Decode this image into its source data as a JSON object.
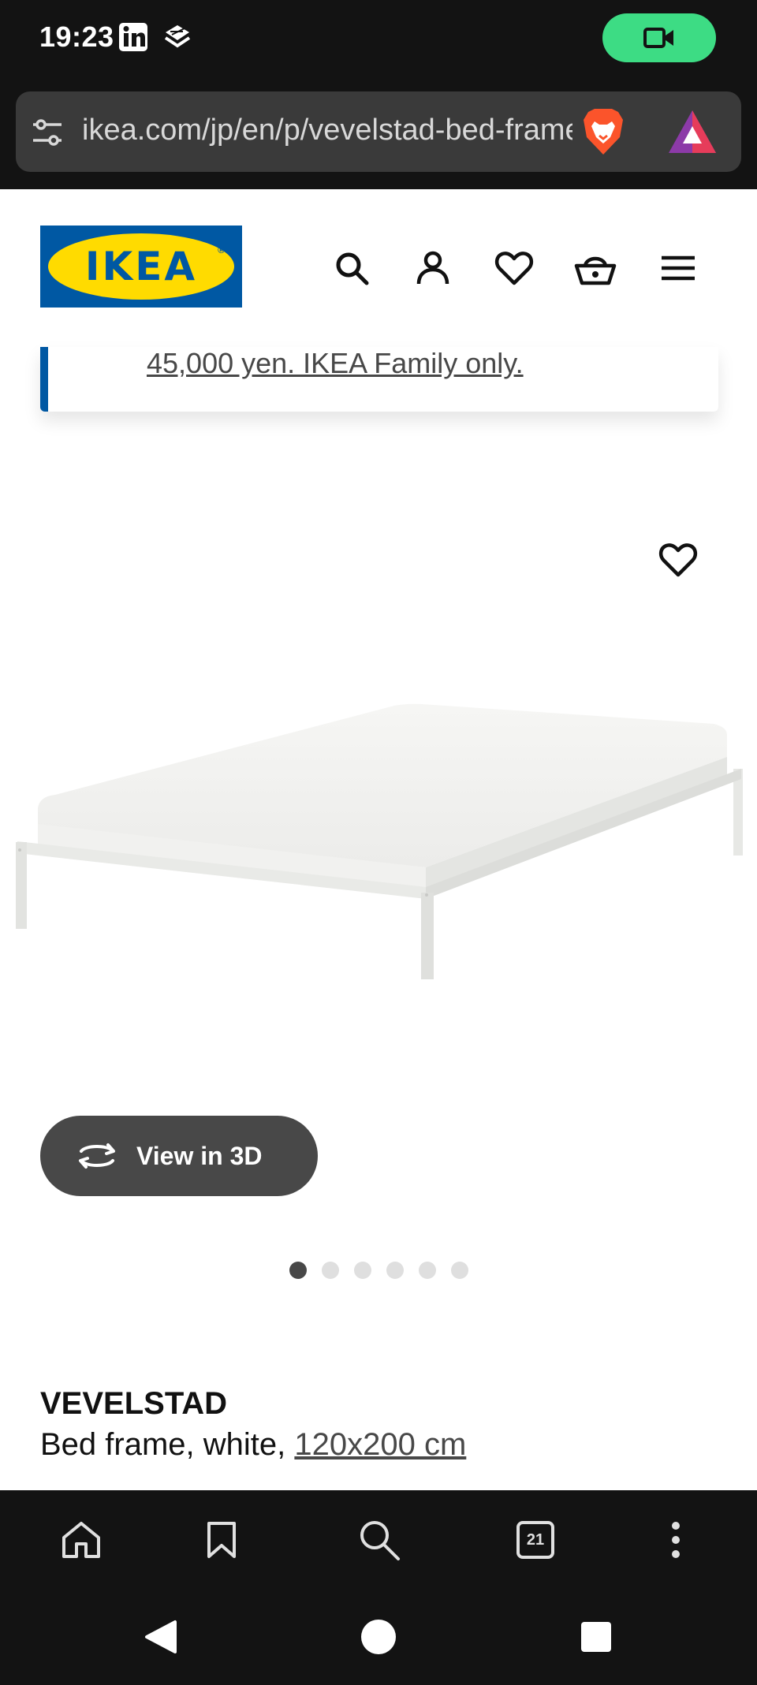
{
  "status_bar": {
    "time": "19:23",
    "notification_icons": [
      "linkedin-icon",
      "stack-icon"
    ],
    "recording_indicator": "video-camera-icon",
    "accent": "#3ddc84"
  },
  "browser": {
    "url": "ikea.com/jp/en/p/vevelstad-bed-frame-white",
    "icons": [
      "tune-icon",
      "brave-shields-icon",
      "brave-rewards-icon"
    ]
  },
  "header": {
    "logo_text": "IKEA",
    "logo_colors": {
      "blue": "#0058a3",
      "yellow": "#ffdb00"
    },
    "icons": [
      "search-icon",
      "account-icon",
      "heart-icon",
      "basket-icon",
      "menu-icon"
    ]
  },
  "promo": {
    "text": "45,000 yen. IKEA Family only."
  },
  "product": {
    "view_3d_label": "View in 3D",
    "gallery_count": 6,
    "gallery_active_index": 0,
    "name": "VEVELSTAD",
    "description": "Bed frame, white, ",
    "size_link": "120x200 cm"
  },
  "bottom_toolbar": {
    "icons": [
      "home-icon",
      "bookmark-icon",
      "search-icon",
      "tabs-icon",
      "more-icon"
    ],
    "tab_count": "21"
  },
  "android_nav": {
    "icons": [
      "back-icon",
      "home-circle-icon",
      "recents-icon"
    ]
  }
}
